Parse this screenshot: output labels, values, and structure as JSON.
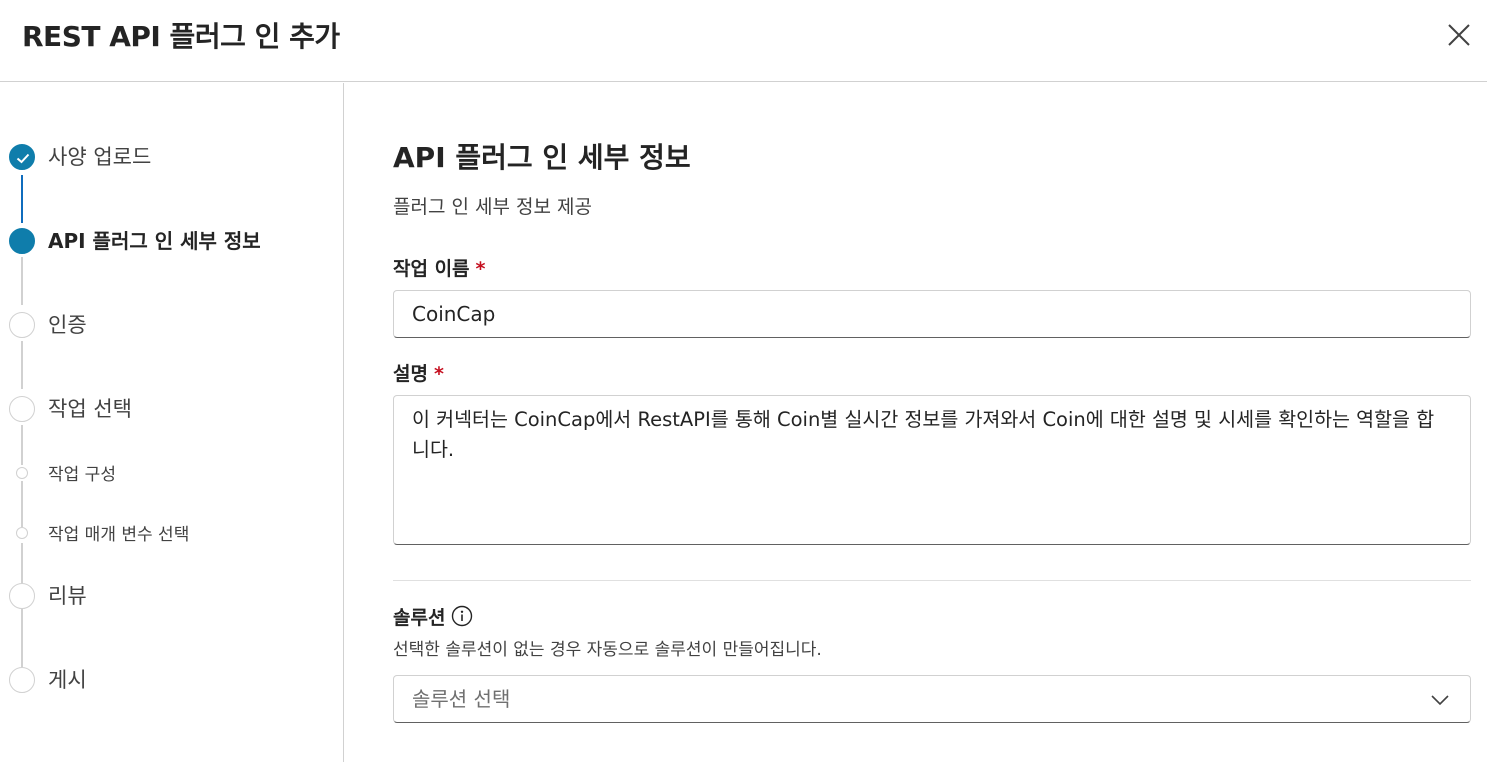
{
  "dialog": {
    "title": "REST API 플러그 인 추가",
    "close_icon": "close-icon"
  },
  "steps": [
    {
      "label": "사양 업로드",
      "status": "completed"
    },
    {
      "label": "API 플러그 인 세부 정보",
      "status": "current"
    },
    {
      "label": "인증",
      "status": "pending"
    },
    {
      "label": "작업 선택",
      "status": "pending"
    },
    {
      "label": "작업 구성",
      "status": "pending",
      "substep": true
    },
    {
      "label": "작업 매개 변수 선택",
      "status": "pending",
      "substep": true
    },
    {
      "label": "리뷰",
      "status": "pending"
    },
    {
      "label": "게시",
      "status": "pending"
    }
  ],
  "main": {
    "title": "API 플러그 인 세부 정보",
    "subtitle": "플러그 인 세부 정보 제공",
    "action_name": {
      "label": "작업 이름",
      "required_mark": "*",
      "value": "CoinCap"
    },
    "description": {
      "label": "설명",
      "required_mark": "*",
      "value": "이 커넥터는 CoinCap에서  RestAPI를 통해 Coin별 실시간 정보를 가져와서 Coin에 대한 설명 및 시세를 확인하는 역할을 합니다."
    },
    "solution": {
      "label": "솔루션",
      "info_icon": "info-icon",
      "hint": "선택한 솔루션이 없는 경우 자동으로 솔루션이 만들어집니다.",
      "placeholder": "솔루션 선택",
      "chevron_icon": "chevron-down-icon"
    }
  },
  "colors": {
    "accent": "#0f7dab",
    "required": "#c50f1f",
    "border": "#d1d1d1"
  }
}
